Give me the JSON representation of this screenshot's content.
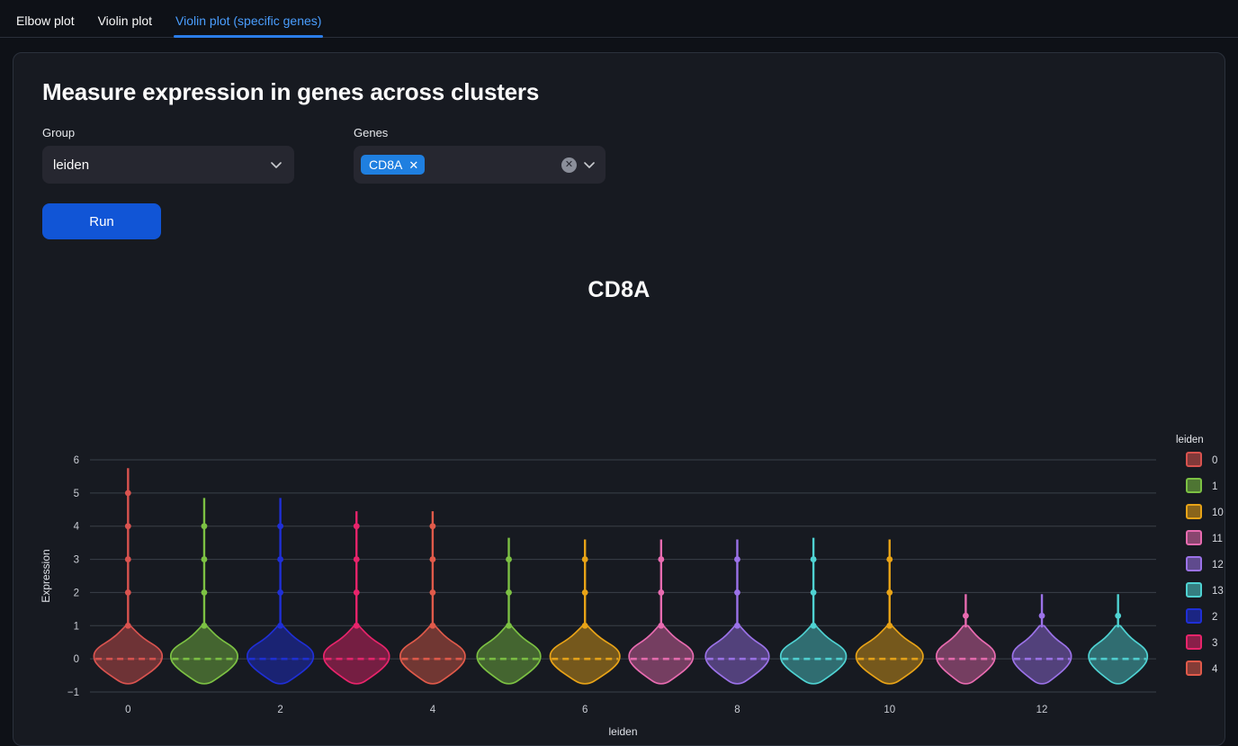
{
  "tabs": [
    {
      "label": "Elbow plot",
      "active": false
    },
    {
      "label": "Violin plot",
      "active": false
    },
    {
      "label": "Violin plot (specific genes)",
      "active": true
    }
  ],
  "card": {
    "title": "Measure expression in genes across clusters",
    "group": {
      "label": "Group",
      "value": "leiden",
      "chevron_icon": "chevron-down-icon"
    },
    "genes": {
      "label": "Genes",
      "chips": [
        "CD8A"
      ],
      "chip_remove_icon": "close-icon",
      "clear_icon": "clear-circle-icon",
      "chevron_icon": "chevron-down-icon"
    },
    "run_label": "Run"
  },
  "chart_data": {
    "type": "violin",
    "title": "CD8A",
    "xlabel": "leiden",
    "ylabel": "Expression",
    "ylim": [
      -1,
      6
    ],
    "yticks": [
      -1,
      0,
      1,
      2,
      3,
      4,
      5,
      6
    ],
    "xticks": [
      0,
      2,
      4,
      6,
      8,
      10,
      12
    ],
    "grid": true,
    "legend": {
      "title": "leiden",
      "position": "right",
      "entries": [
        {
          "label": "0",
          "color": "#d9534f"
        },
        {
          "label": "1",
          "color": "#7cc143"
        },
        {
          "label": "10",
          "color": "#e8a317"
        },
        {
          "label": "11",
          "color": "#e86bb0"
        },
        {
          "label": "12",
          "color": "#9b72e8"
        },
        {
          "label": "13",
          "color": "#4fd2d2"
        },
        {
          "label": "2",
          "color": "#1f2fd6"
        },
        {
          "label": "3",
          "color": "#e8246b"
        },
        {
          "label": "4",
          "color": "#e05a4a"
        }
      ]
    },
    "categories": [
      "0",
      "1",
      "2",
      "3",
      "4",
      "5",
      "6",
      "7",
      "8",
      "9",
      "10",
      "11",
      "12",
      "13"
    ],
    "violins": [
      {
        "category": "0",
        "color": "#d9534f",
        "median": 0.0,
        "max": 5.75,
        "points": [
          5.0,
          4.0,
          3.0,
          2.0,
          1.0
        ],
        "body_top": 1.0,
        "bulb_scale": 1.0
      },
      {
        "category": "1",
        "color": "#7cc143",
        "median": 0.0,
        "max": 4.85,
        "points": [
          4.0,
          3.0,
          2.0,
          1.0
        ],
        "body_top": 1.0,
        "bulb_scale": 0.98
      },
      {
        "category": "2",
        "color": "#1f2fd6",
        "median": 0.0,
        "max": 4.85,
        "points": [
          4.0,
          3.0,
          2.0,
          1.0
        ],
        "body_top": 1.0,
        "bulb_scale": 0.97
      },
      {
        "category": "3",
        "color": "#e8246b",
        "median": 0.0,
        "max": 4.45,
        "points": [
          4.0,
          3.0,
          2.0,
          1.0
        ],
        "body_top": 1.0,
        "bulb_scale": 0.96
      },
      {
        "category": "4",
        "color": "#e05a4a",
        "median": 0.0,
        "max": 4.45,
        "points": [
          4.0,
          3.0,
          2.0,
          1.0
        ],
        "body_top": 1.0,
        "bulb_scale": 0.95
      },
      {
        "category": "5",
        "color": "#7cc143",
        "median": 0.0,
        "max": 3.65,
        "points": [
          3.0,
          2.0,
          1.0
        ],
        "body_top": 1.0,
        "bulb_scale": 0.93
      },
      {
        "category": "6",
        "color": "#e8a317",
        "median": 0.0,
        "max": 3.6,
        "points": [
          3.0,
          2.0,
          1.0
        ],
        "body_top": 1.0,
        "bulb_scale": 1.02
      },
      {
        "category": "7",
        "color": "#e86bb0",
        "median": 0.0,
        "max": 3.6,
        "points": [
          3.0,
          2.0,
          1.0
        ],
        "body_top": 1.0,
        "bulb_scale": 0.94
      },
      {
        "category": "8",
        "color": "#9b72e8",
        "median": 0.0,
        "max": 3.6,
        "points": [
          3.0,
          2.0,
          1.0
        ],
        "body_top": 1.0,
        "bulb_scale": 0.93
      },
      {
        "category": "9",
        "color": "#4fd2d2",
        "median": 0.0,
        "max": 3.65,
        "points": [
          3.0,
          2.0,
          1.0
        ],
        "body_top": 1.0,
        "bulb_scale": 0.96
      },
      {
        "category": "10",
        "color": "#e8a317",
        "median": 0.0,
        "max": 3.6,
        "points": [
          3.0,
          2.0,
          1.0
        ],
        "body_top": 1.0,
        "bulb_scale": 0.98
      },
      {
        "category": "11",
        "color": "#e86bb0",
        "median": 0.0,
        "max": 1.95,
        "points": [
          1.3
        ],
        "body_top": 1.0,
        "bulb_scale": 0.86
      },
      {
        "category": "12",
        "color": "#9b72e8",
        "median": 0.0,
        "max": 1.95,
        "points": [
          1.3
        ],
        "body_top": 1.0,
        "bulb_scale": 0.86
      },
      {
        "category": "13",
        "color": "#4fd2d2",
        "median": 0.0,
        "max": 1.95,
        "points": [
          1.3
        ],
        "body_top": 1.0,
        "bulb_scale": 0.86
      }
    ]
  }
}
